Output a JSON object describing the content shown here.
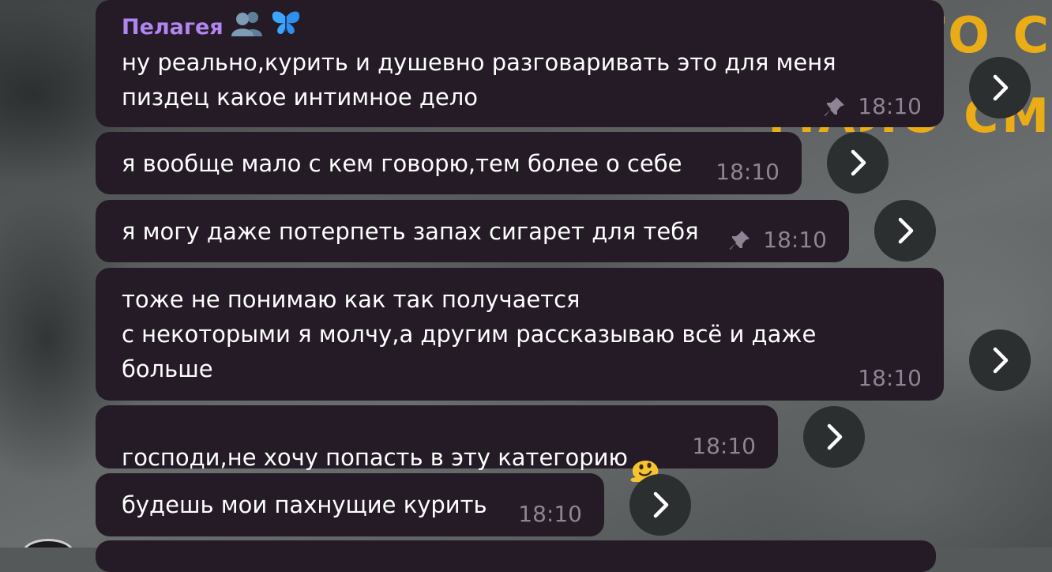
{
  "sender": "Пелагея",
  "messages": [
    {
      "text": "ну реально,курить и душевно разговаривать это для меня\nпиздец какое интимное дело",
      "time": "18:10",
      "pinned": true
    },
    {
      "text": "я вообще мало с кем говорю,тем более о себе",
      "time": "18:10",
      "pinned": false
    },
    {
      "text": "я могу даже потерпеть запах сигарет для тебя",
      "time": "18:10",
      "pinned": true
    },
    {
      "text": "тоже не понимаю как так получается\nс некоторыми я молчу,а другим рассказываю всё и даже\nбольше",
      "time": "18:10",
      "pinned": false
    },
    {
      "text": "господи,не хочу попасть в эту категорию",
      "time": "18:10",
      "pinned": false
    },
    {
      "text": "будешь мои пахнущие курить",
      "time": "18:10",
      "pinned": false
    }
  ],
  "background_text": {
    "line1": "ТО С",
    "line2": "МАЛО СМ"
  },
  "icons": {
    "sender_badges": [
      "people-emoji-icon",
      "butterfly-emoji-icon"
    ],
    "message_emoji": "melting-face-emoji-icon",
    "forward": "chevron-right-icon",
    "pin": "pin-icon"
  },
  "colors": {
    "bubble": "#241b26",
    "sender_name": "#b286f0",
    "meta": "#8d8494",
    "forward_button": "#2b2f30",
    "background_text": "#f2b112"
  }
}
